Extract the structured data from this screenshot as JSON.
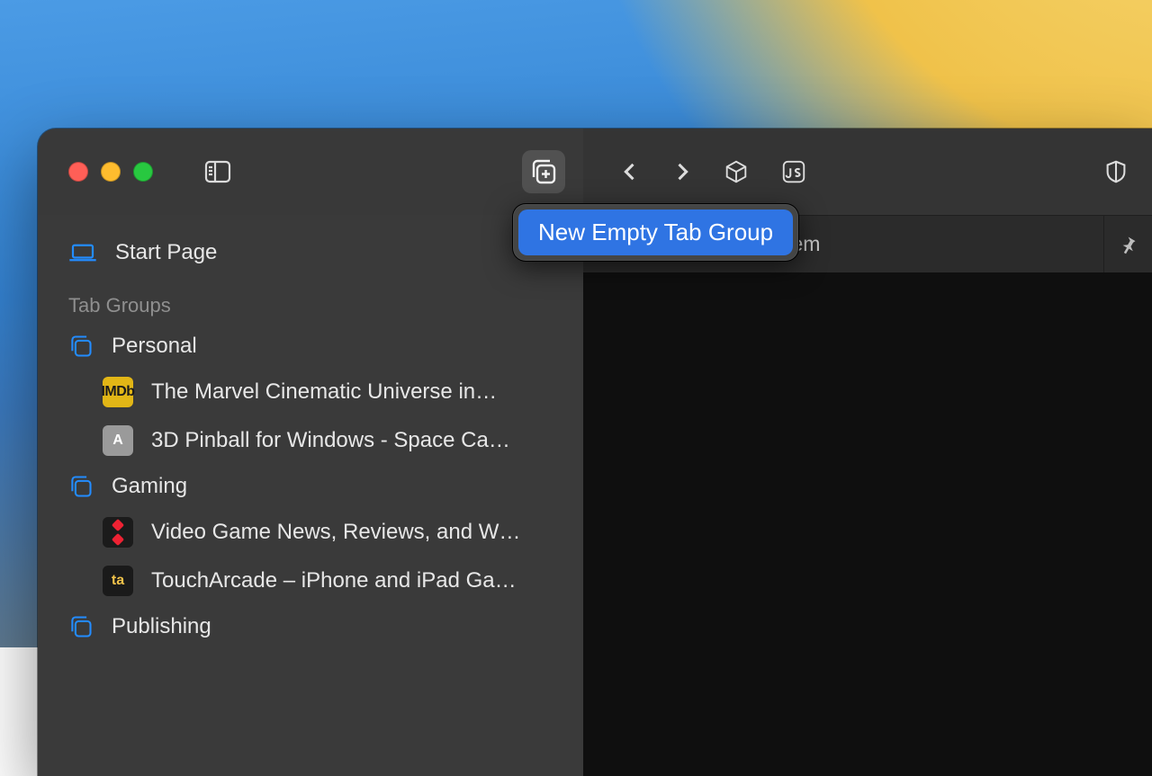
{
  "sidebar": {
    "start_page": "Start Page",
    "section_label": "Tab Groups",
    "groups": [
      {
        "name": "Personal",
        "tabs": [
          {
            "title": "The Marvel Cinematic Universe in…",
            "favicon": "imdb"
          },
          {
            "title": "3D Pinball for Windows - Space Ca…",
            "favicon": "a"
          }
        ]
      },
      {
        "name": "Gaming",
        "tabs": [
          {
            "title": "Video Game News, Reviews, and W…",
            "favicon": "ign"
          },
          {
            "title": "TouchArcade – iPhone and iPad Ga…",
            "favicon": "ta"
          }
        ]
      },
      {
        "name": "Publishing",
        "tabs": []
      }
    ]
  },
  "popover": {
    "item": "New Empty Tab Group"
  },
  "content": {
    "tab_title_fragment": "sider Publishing System"
  }
}
